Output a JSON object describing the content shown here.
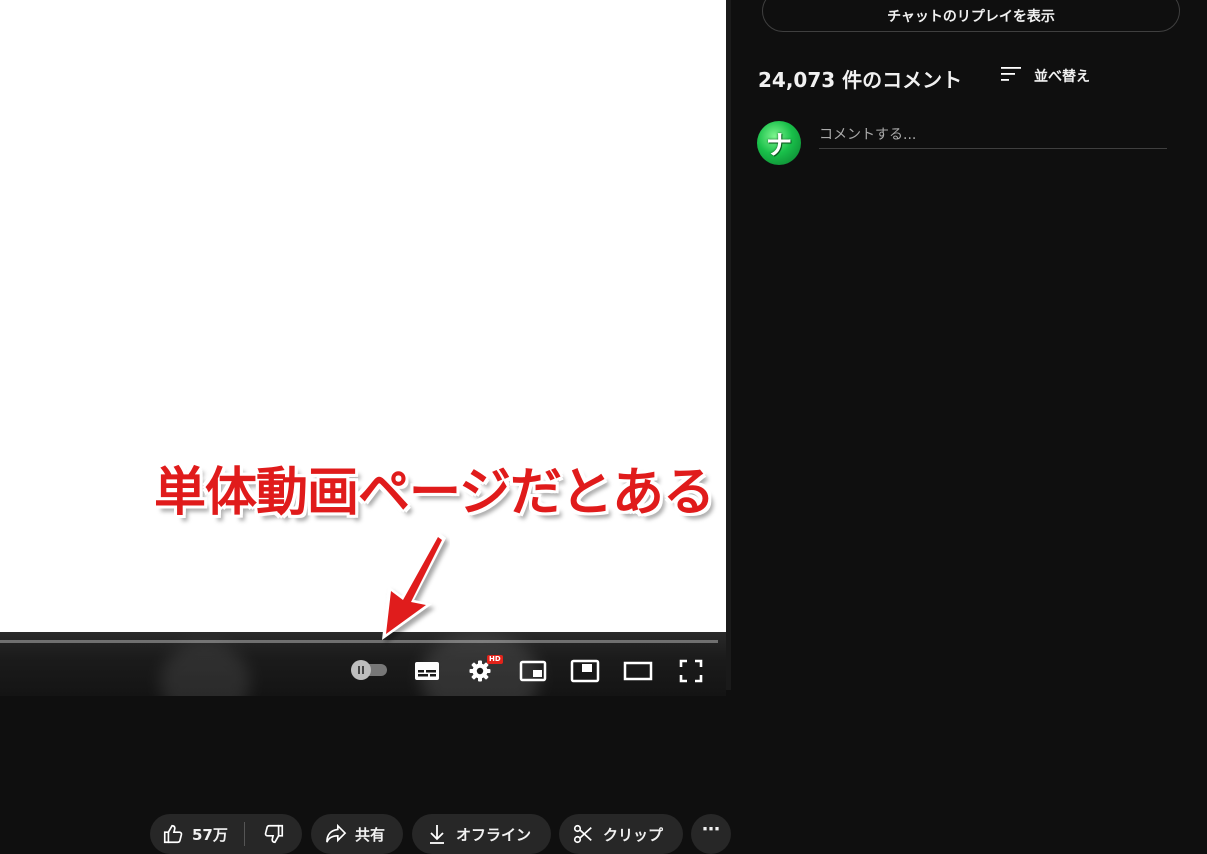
{
  "player": {
    "hd_badge": "HD",
    "controls": [
      "autoplay-toggle",
      "subtitles-icon",
      "settings-icon",
      "miniplayer-icon",
      "theater-mode-icon",
      "pip-icon",
      "fullscreen-icon"
    ]
  },
  "annotation": {
    "text": "単体動画ページだとある",
    "color": "#e01b1b"
  },
  "actions": {
    "like_count": "57万",
    "share_label": "共有",
    "offline_label": "オフライン",
    "clip_label": "クリップ",
    "more_label": "⋯"
  },
  "sidebar": {
    "chat_replay_label": "チャットのリプレイを表示",
    "comments_count": "24,073 件のコメント",
    "sort_label": "並べ替え",
    "avatar_glyph": "ナ",
    "comment_placeholder": "コメントする..."
  },
  "colors": {
    "background": "#0f0f0f",
    "pill": "#272727",
    "hd_badge": "#e2231a",
    "avatar": "#19c04a"
  }
}
